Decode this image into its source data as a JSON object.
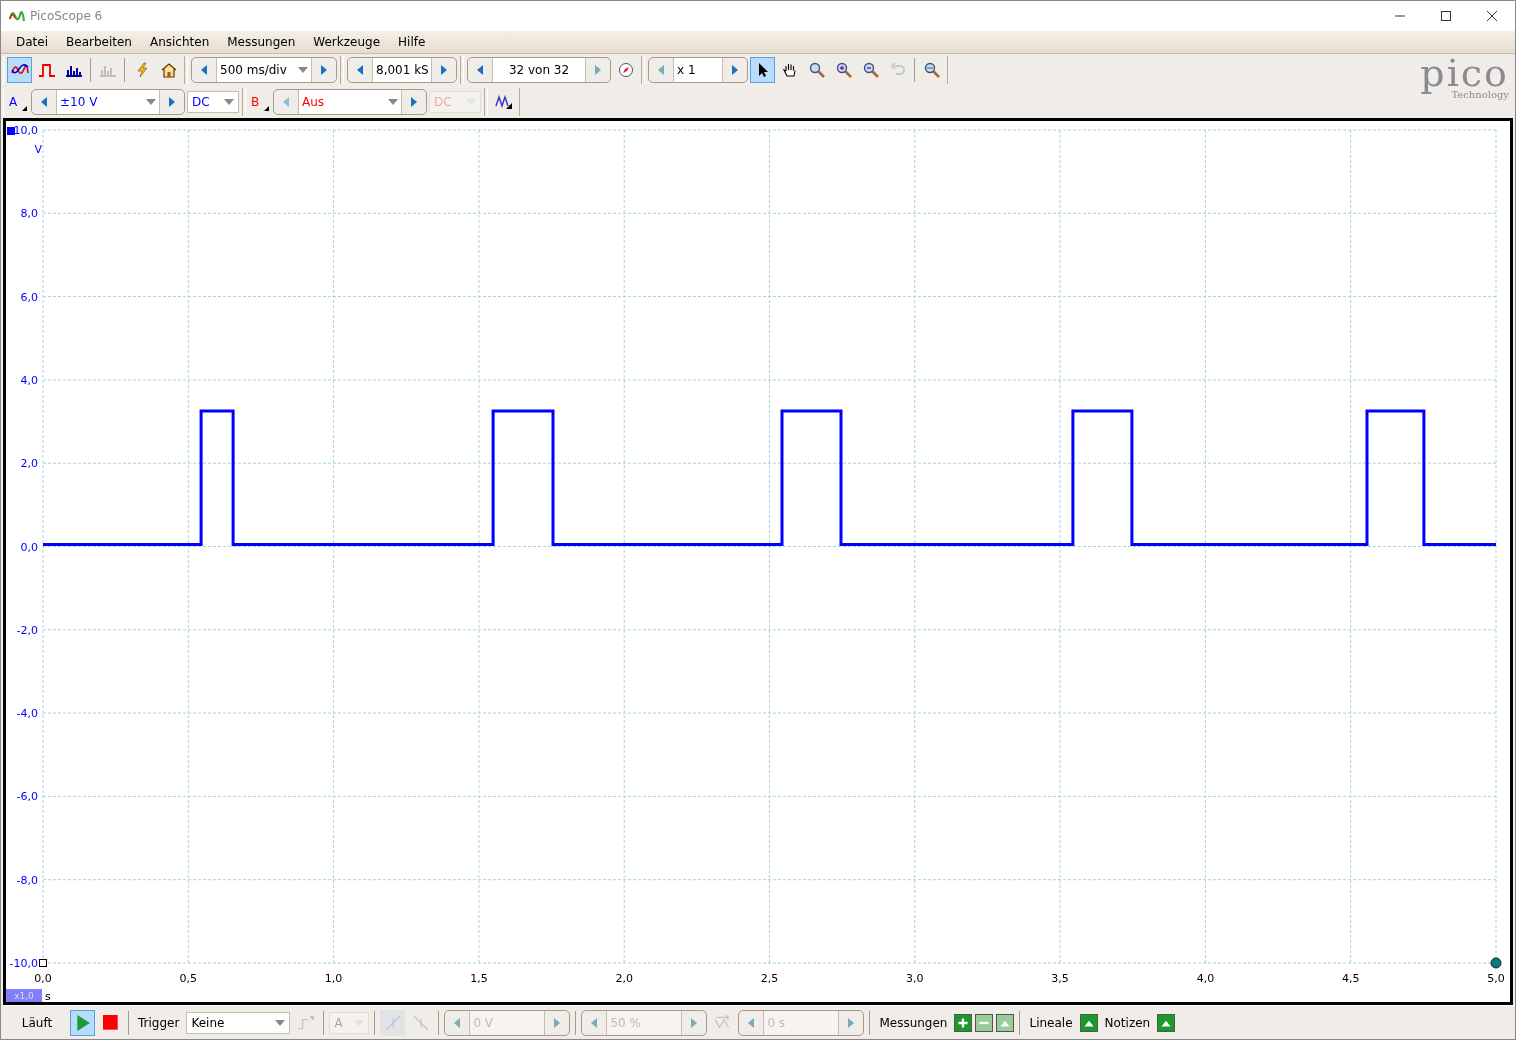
{
  "window": {
    "title": "PicoScope 6"
  },
  "menu": [
    "Datei",
    "Bearbeiten",
    "Ansichten",
    "Messungen",
    "Werkzeuge",
    "Hilfe"
  ],
  "toolbar": {
    "mode_buttons": [
      {
        "selected": true,
        "disabled": false
      },
      {
        "selected": false,
        "disabled": false
      },
      {
        "selected": false,
        "disabled": false
      },
      {
        "selected": false,
        "disabled": true
      }
    ],
    "timebase": "500 ms/div",
    "samples": "8,001 kS",
    "buffer": "32 von 32",
    "zoom_factor": "x 1",
    "tools": [
      {
        "selected": true,
        "disabled": false
      },
      {
        "selected": false,
        "disabled": false
      },
      {
        "selected": false,
        "disabled": false
      },
      {
        "selected": false,
        "disabled": false
      },
      {
        "selected": false,
        "disabled": false
      },
      {
        "selected": false,
        "disabled": true
      },
      {
        "selected": false,
        "disabled": false
      }
    ]
  },
  "logo": {
    "name": "pico",
    "tagline": "Technology"
  },
  "channels": [
    {
      "label": "A",
      "color": "#0000ff",
      "range": "±10 V",
      "coupling": "DC",
      "enabled": true
    },
    {
      "label": "B",
      "color": "#ff0000",
      "range": "Aus",
      "coupling": "DC",
      "enabled": false
    }
  ],
  "plot": {
    "zoom_badge": "x1,0",
    "chart_data": {
      "type": "line",
      "grid": true,
      "xlabel": "s",
      "ylabel": "V",
      "xlim": [
        0,
        5
      ],
      "ylim": [
        -10,
        10
      ],
      "xticks": [
        {
          "value": 0,
          "label": "0,0"
        },
        {
          "value": 0.5,
          "label": "0,5"
        },
        {
          "value": 1,
          "label": "1,0"
        },
        {
          "value": 1.5,
          "label": "1,5"
        },
        {
          "value": 2,
          "label": "2,0"
        },
        {
          "value": 2.5,
          "label": "2,5"
        },
        {
          "value": 3,
          "label": "3,0"
        },
        {
          "value": 3.5,
          "label": "3,5"
        },
        {
          "value": 4,
          "label": "4,0"
        },
        {
          "value": 4.5,
          "label": "4,5"
        },
        {
          "value": 5,
          "label": "5,0"
        }
      ],
      "yticks": [
        {
          "value": 10,
          "label": "10,0"
        },
        {
          "value": 8,
          "label": "8,0"
        },
        {
          "value": 6,
          "label": "6,0"
        },
        {
          "value": 4,
          "label": "4,0"
        },
        {
          "value": 2,
          "label": "2,0"
        },
        {
          "value": 0,
          "label": "0,0"
        },
        {
          "value": -2,
          "label": "-2,0"
        },
        {
          "value": -4,
          "label": "-4,0"
        },
        {
          "value": -6,
          "label": "-6,0"
        },
        {
          "value": -8,
          "label": "-8,0"
        },
        {
          "value": -10,
          "label": "-10,0"
        }
      ],
      "x": [
        0,
        0.544,
        0.544,
        0.654,
        0.654,
        1.549,
        1.549,
        1.755,
        1.755,
        2.543,
        2.543,
        2.746,
        2.746,
        3.544,
        3.544,
        3.747,
        3.747,
        4.556,
        4.556,
        4.752,
        4.752,
        5
      ],
      "series": [
        {
          "color": "#0000ff",
          "values": [
            0.05,
            0.05,
            3.25,
            3.25,
            0.05,
            0.05,
            3.25,
            3.25,
            0.05,
            0.05,
            3.25,
            3.25,
            0.05,
            0.05,
            3.25,
            3.25,
            0.05,
            0.05,
            3.25,
            3.25,
            0.05,
            0.05
          ]
        }
      ]
    }
  },
  "status": {
    "run_label": "Läuft",
    "run": {
      "selected": true
    },
    "trigger_label": "Trigger",
    "trigger_mode": "Keine",
    "trigger_channel": "A",
    "threshold": "0 V",
    "pretrigger": "50 %",
    "delay": "0 s",
    "measurements": "Messungen",
    "rulers": "Lineale",
    "notes": "Notizen"
  }
}
